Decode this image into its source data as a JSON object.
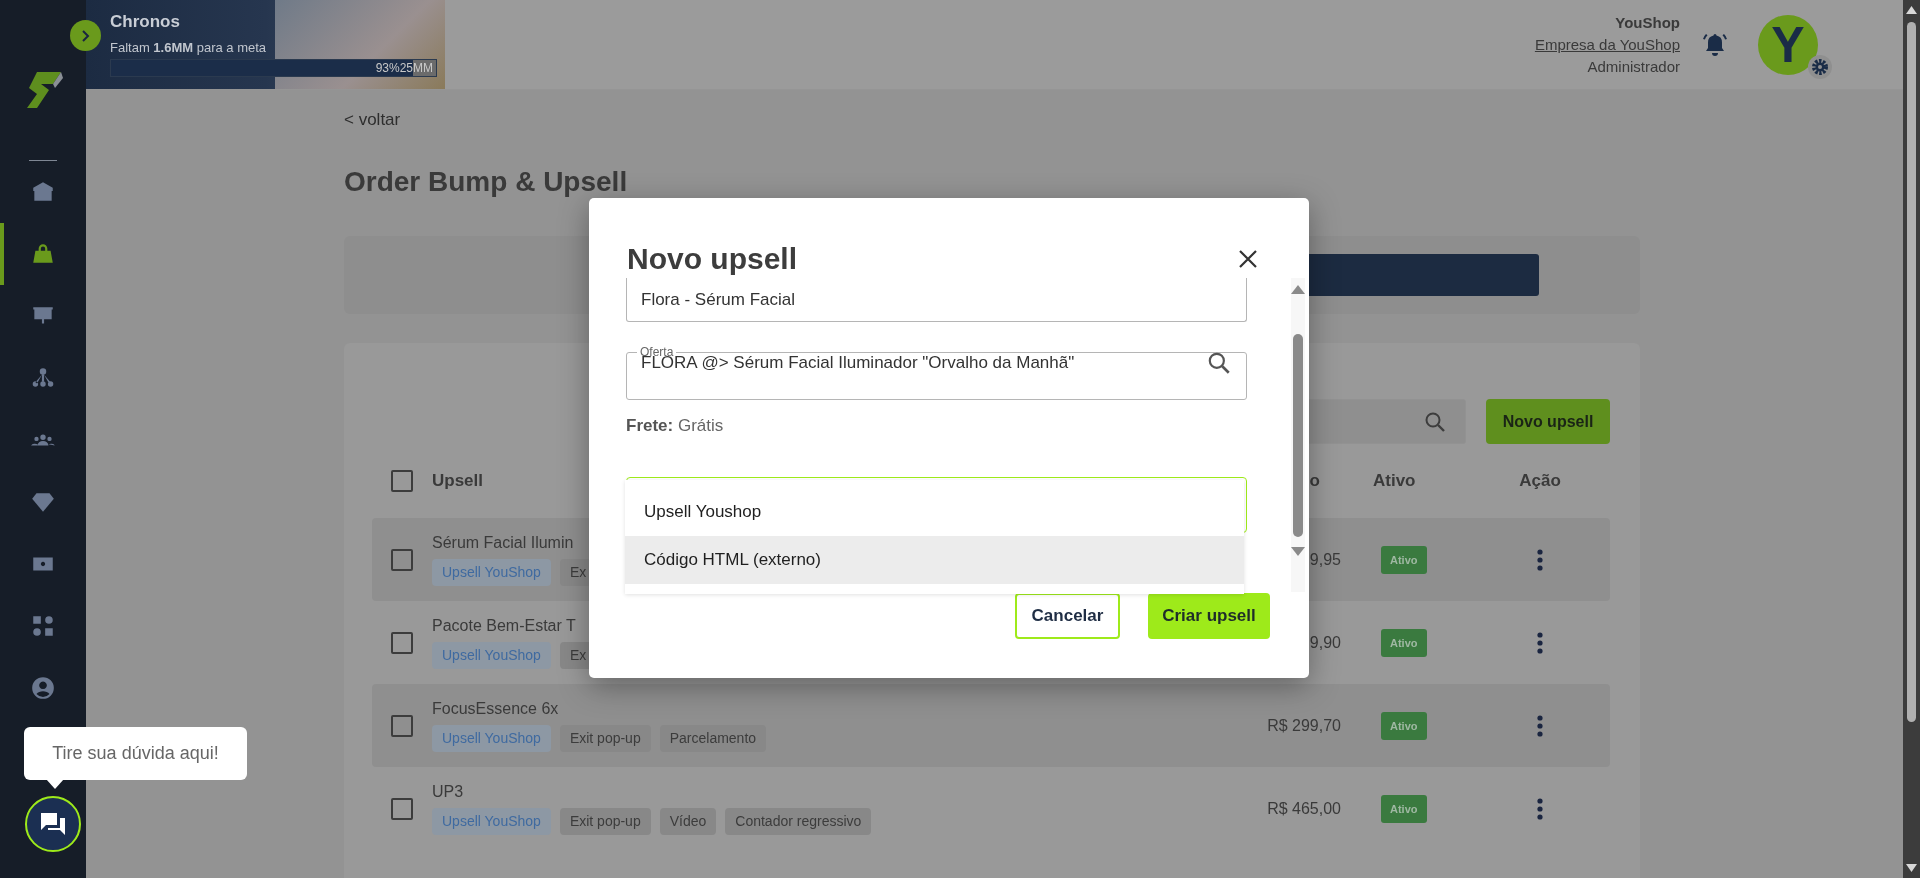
{
  "sidebar": {
    "items": [
      {
        "selected": false
      },
      {
        "selected": true
      },
      {
        "selected": false
      },
      {
        "selected": false
      },
      {
        "selected": false
      },
      {
        "selected": false
      },
      {
        "selected": false
      },
      {
        "selected": false
      },
      {
        "selected": false
      }
    ]
  },
  "banner": {
    "title": "Chronos",
    "subtitle": "Faltam **1.6MM** para a meta",
    "progress": {
      "level": 0.93,
      "percent": "93%",
      "goal": "25MM"
    }
  },
  "user": {
    "company": "YouShop",
    "company_link": "Empresa da YouShop",
    "role": "Administrador",
    "avatar_letter": "Y"
  },
  "back_link": "< voltar",
  "page_title": "Order Bump & Upsell",
  "toolbar": {
    "new_button": "Novo upsell"
  },
  "table": {
    "header_checked": false,
    "columns": [
      "Upsell",
      "o",
      "Ativo",
      "Ação"
    ],
    "rows": [
      {
        "name": "Sérum Facial Ilumin",
        "checked": false,
        "tags": [
          {
            "label": "Upsell YouShop",
            "kind": "type"
          },
          {
            "label": "Ex",
            "kind": "feature"
          }
        ],
        "price": "9,95",
        "status": "Ativo"
      },
      {
        "name": "Pacote Bem-Estar T",
        "checked": false,
        "tags": [
          {
            "label": "Upsell YouShop",
            "kind": "type"
          },
          {
            "label": "Ex",
            "kind": "feature"
          }
        ],
        "price": "9,90",
        "status": "Ativo"
      },
      {
        "name": "FocusEssence 6x",
        "checked": false,
        "tags": [
          {
            "label": "Upsell YouShop",
            "kind": "type"
          },
          {
            "label": "Exit pop-up",
            "kind": "feature"
          },
          {
            "label": "Parcelamento",
            "kind": "feature"
          }
        ],
        "price": "R$ 299,70",
        "status": "Ativo"
      },
      {
        "name": "UP3",
        "checked": false,
        "tags": [
          {
            "label": "Upsell YouShop",
            "kind": "type"
          },
          {
            "label": "Exit pop-up",
            "kind": "feature"
          },
          {
            "label": "Vídeo",
            "kind": "feature"
          },
          {
            "label": "Contador regressivo",
            "kind": "feature"
          }
        ],
        "price": "R$ 465,00",
        "status": "Ativo"
      }
    ]
  },
  "modal": {
    "title": "Novo upsell",
    "name_field": {
      "value": "Flora - Sérum Facial"
    },
    "offer_field": {
      "label": "Oferta",
      "value": "FLORA @> Sérum Facial Iluminador \"Orvalho da Manhã\""
    },
    "shipping": "**Frete:** Grátis",
    "type_options": [
      {
        "label": "Upsell Youshop",
        "highlighted": false
      },
      {
        "label": "Código HTML (externo)",
        "highlighted": true
      }
    ],
    "cancel_button": "Cancelar",
    "submit_button": "Criar upsell"
  },
  "chat": {
    "tooltip": "Tire sua dúvida aqui!"
  }
}
